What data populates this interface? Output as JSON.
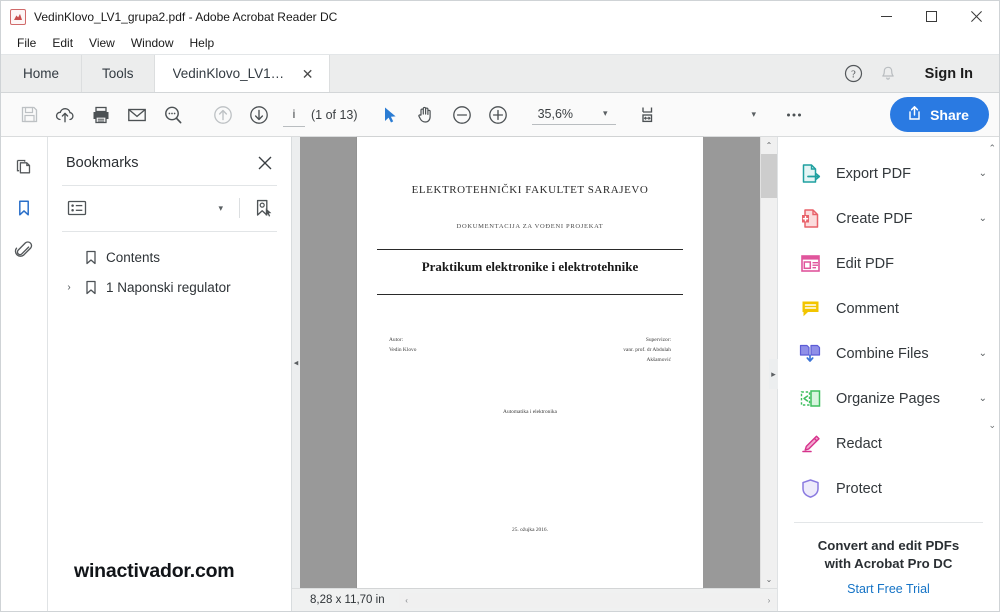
{
  "window": {
    "title": "VedinKlovo_LV1_grupa2.pdf - Adobe Acrobat Reader DC",
    "app_icon": "pdf-file-icon",
    "minimize": "–",
    "maximize": "□",
    "close": "✕"
  },
  "menubar": {
    "items": [
      {
        "label": "File"
      },
      {
        "label": "Edit"
      },
      {
        "label": "View"
      },
      {
        "label": "Window"
      },
      {
        "label": "Help"
      }
    ]
  },
  "tabs": {
    "home": "Home",
    "tools": "Tools",
    "document": "VedinKlovo_LV1_gr...",
    "close_glyph": "✕",
    "help_icon": "help-circle-icon",
    "bell_icon": "notification-bell-icon",
    "signin": "Sign In"
  },
  "toolbar": {
    "save": "save-icon",
    "cloud": "cloud-upload-icon",
    "print": "print-icon",
    "email": "email-icon",
    "search": "search-icon",
    "previous_page": "arrow-up-icon",
    "next_page": "arrow-down-icon",
    "info": "i",
    "page_count": "(1 of 13)",
    "select_tool": "cursor-arrow-icon",
    "hand_tool": "hand-icon",
    "zoom_out": "zoom-out-icon",
    "zoom_in": "zoom-in-icon",
    "zoom_value": "35,6%",
    "zoom_caret": "▾",
    "fit_page": "fit-page-icon",
    "fit_caret": "▾",
    "more": "•••",
    "share_label": "Share",
    "share_icon": "share-upload-icon",
    "share_color": "#2a7ae2"
  },
  "rail": {
    "items": [
      {
        "icon": "page-thumbnails-icon",
        "selected": false
      },
      {
        "icon": "bookmark-icon",
        "selected": true
      },
      {
        "icon": "attachment-paperclip-icon",
        "selected": false
      }
    ],
    "selected_color": "#2a6fc9"
  },
  "bookmarks": {
    "title": "Bookmarks",
    "close_glyph": "✕",
    "options_icon": "list-options-icon",
    "options_caret": "▾",
    "new_bookmark_icon": "new-bookmark-icon",
    "items": [
      {
        "label": "Contents",
        "expandable": false,
        "expander": ""
      },
      {
        "label": "1 Naponski regulator",
        "expandable": true,
        "expander": "›"
      }
    ],
    "watermark": "winactivador.com"
  },
  "document": {
    "university": "ELEKTROTEHNIČKI FAKULTET SARAJEVO",
    "subtitle": "DOKUMENTACIJA ZA VOĐENI PROJEKAT",
    "title": "Praktikum elektronike i elektrotehnike",
    "author_label": "Autor:",
    "author_name": "Vedin Klovo",
    "supervisor_label": "Supervizor:",
    "supervisor_name_1": "vanr. prof. dr Abdulah",
    "supervisor_name_2": "Akšamović",
    "department": "Automatika i elektronika",
    "date": "25. ožujka 2016.",
    "page_bg": "#ffffff",
    "gutter_color": "#999999"
  },
  "statusbar": {
    "dimensions": "8,28 x 11,70 in",
    "scroll_left": "‹",
    "scroll_right": "›"
  },
  "tools_panel": {
    "items": [
      {
        "label": "Export PDF",
        "icon": "export-pdf-icon",
        "color": "#1fa0a0",
        "caret": "⌄"
      },
      {
        "label": "Create PDF",
        "icon": "create-pdf-icon",
        "color": "#e8626a",
        "caret": "⌄"
      },
      {
        "label": "Edit PDF",
        "icon": "edit-pdf-icon",
        "color": "#e0559c",
        "caret": ""
      },
      {
        "label": "Comment",
        "icon": "comment-icon",
        "color": "#f2c500",
        "caret": ""
      },
      {
        "label": "Combine Files",
        "icon": "combine-files-icon",
        "color": "#6a6ae0",
        "caret": "⌄"
      },
      {
        "label": "Organize Pages",
        "icon": "organize-pages-icon",
        "color": "#3fbf5f",
        "caret": "⌄"
      },
      {
        "label": "Redact",
        "icon": "redact-icon",
        "color": "#d6338c",
        "caret": ""
      },
      {
        "label": "Protect",
        "icon": "protect-shield-icon",
        "color": "#8a7ae0",
        "caret": ""
      }
    ],
    "promo_line_1": "Convert and edit PDFs",
    "promo_line_2": "with Acrobat Pro DC",
    "promo_link": "Start Free Trial",
    "promo_link_color": "#1473c6",
    "scroll_up": "⌃",
    "scroll_down": "⌄"
  },
  "scroll": {
    "up_glyph": "⌃",
    "down_glyph": "⌄",
    "collapse_left": "◂",
    "collapse_right": "▸"
  }
}
